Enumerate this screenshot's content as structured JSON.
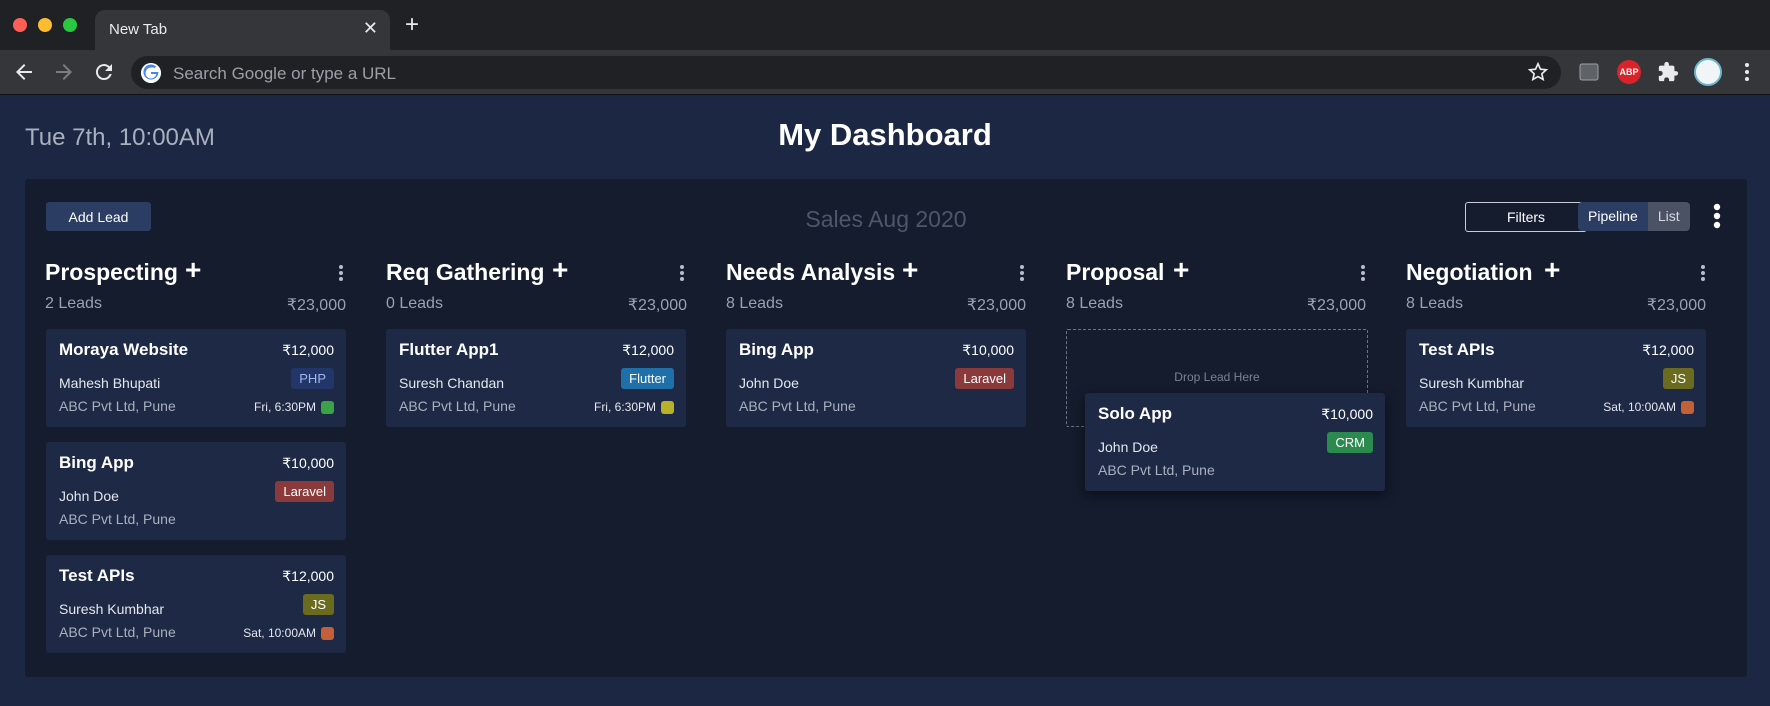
{
  "browser": {
    "tab_title": "New Tab",
    "tab_close": "✕",
    "new_tab": "+",
    "omnibox_placeholder": "Search Google or type a URL",
    "ext_abp": "ABP",
    "icons": [
      "back-icon",
      "forward-icon",
      "reload-icon",
      "google-icon",
      "star-icon",
      "cast-icon",
      "adblock-icon",
      "puzzle-icon",
      "avatar",
      "menu-icon"
    ]
  },
  "page": {
    "datetime": "Tue 7th, 10:00AM",
    "title": "My Dashboard"
  },
  "board": {
    "add_lead": "Add Lead",
    "title": "Sales Aug 2020",
    "filters": "Filters",
    "view_pipeline": "Pipeline",
    "view_list": "List",
    "drop_text": "Drop Lead Here"
  },
  "columns": [
    {
      "title": "Prospecting",
      "count": "2 Leads",
      "amount": "₹23,000"
    },
    {
      "title": "Req Gathering",
      "count": "0 Leads",
      "amount": "₹23,000"
    },
    {
      "title": "Needs Analysis",
      "count": "8 Leads",
      "amount": "₹23,000"
    },
    {
      "title": "Proposal",
      "count": "8 Leads",
      "amount": "₹23,000"
    },
    {
      "title": "Negotiation",
      "count": "8 Leads",
      "amount": "₹23,000"
    }
  ],
  "cards": [
    {
      "title": "Moraya Website",
      "amount": "₹12,000",
      "person": "Mahesh Bhupati",
      "company": "ABC Pvt Ltd, Pune",
      "tag": "PHP",
      "tag_color": "#23366a",
      "tag_text_color": "#9fb6f0",
      "schedule": "Fri, 6:30PM",
      "sched_icon": "phone-icon",
      "sched_color": "#3aa34a"
    },
    {
      "title": "Bing App",
      "amount": "₹10,000",
      "person": "John Doe",
      "company": "ABC Pvt Ltd, Pune",
      "tag": "Laravel",
      "tag_color": "#8a3a3a",
      "tag_text_color": "#ffffff"
    },
    {
      "title": "Test APIs",
      "amount": "₹12,000",
      "person": "Suresh Kumbhar",
      "company": "ABC Pvt Ltd, Pune",
      "tag": "JS",
      "tag_color": "#6b6b1f",
      "tag_text_color": "#ffffff",
      "schedule": "Sat, 10:00AM",
      "sched_icon": "email-icon",
      "sched_color": "#c2603a"
    },
    {
      "title": "Flutter App1",
      "amount": "₹12,000",
      "person": "Suresh Chandan",
      "company": "ABC Pvt Ltd, Pune",
      "tag": "Flutter",
      "tag_color": "#1f6fa8",
      "tag_text_color": "#ffffff",
      "schedule": "Fri, 6:30PM",
      "sched_icon": "meeting-icon",
      "sched_color": "#b8b12a"
    },
    {
      "title": "Bing App",
      "amount": "₹10,000",
      "person": "John Doe",
      "company": "ABC Pvt Ltd, Pune",
      "tag": "Laravel",
      "tag_color": "#8a3a3a",
      "tag_text_color": "#ffffff"
    },
    {
      "title": "Solo App",
      "amount": "₹10,000",
      "person": "John Doe",
      "company": "ABC Pvt Ltd, Pune",
      "tag": "CRM",
      "tag_color": "#2b8a4e",
      "tag_text_color": "#ffffff"
    },
    {
      "title": "Test APIs",
      "amount": "₹12,000",
      "person": "Suresh Kumbhar",
      "company": "ABC Pvt Ltd, Pune",
      "tag": "JS",
      "tag_color": "#6b6b1f",
      "tag_text_color": "#ffffff",
      "schedule": "Sat, 10:00AM",
      "sched_icon": "email-icon",
      "sched_color": "#c2603a"
    }
  ]
}
